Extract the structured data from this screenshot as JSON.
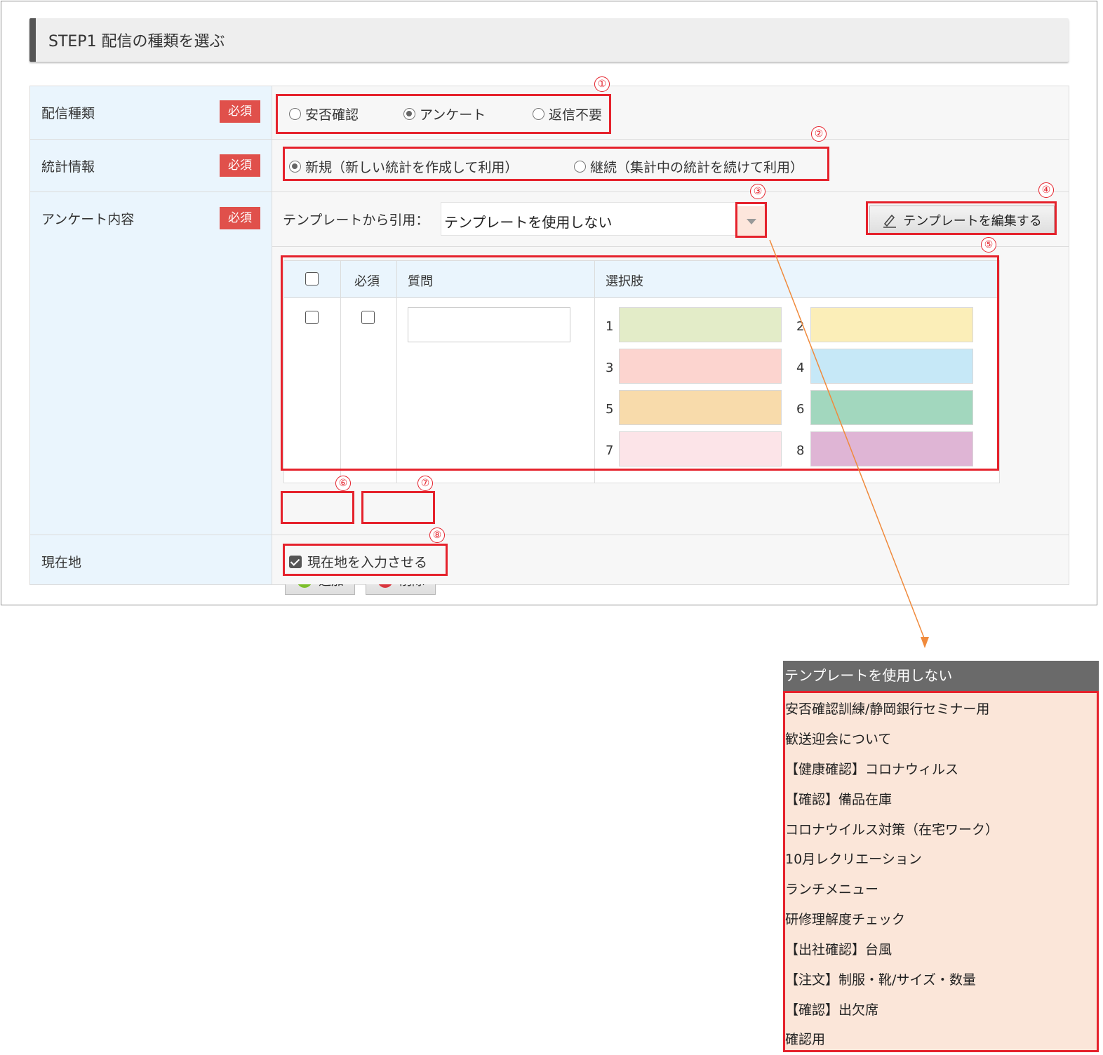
{
  "step": {
    "title": "STEP1 配信の種類を選ぶ"
  },
  "required_badge": "必須",
  "rows": {
    "delivery_type": {
      "label": "配信種類",
      "options": [
        "安否確認",
        "アンケート",
        "返信不要"
      ],
      "selected": "アンケート"
    },
    "statistics": {
      "label": "統計情報",
      "options": [
        "新規（新しい統計を作成して利用）",
        "継続（集計中の統計を続けて利用）"
      ],
      "selected": "新規（新しい統計を作成して利用）"
    },
    "survey": {
      "label": "アンケート内容",
      "template_label": "テンプレートから引用：",
      "template_value": "テンプレートを使用しない",
      "edit_template_button": "テンプレートを編集する",
      "table": {
        "headers": {
          "required": "必須",
          "question": "質問",
          "choices": "選択肢"
        },
        "choice_numbers": [
          "1",
          "2",
          "3",
          "4",
          "5",
          "6",
          "7",
          "8"
        ],
        "choice_colors": [
          "#e3ecc8",
          "#fbeeb8",
          "#fcd4cf",
          "#c6e8f7",
          "#f8dbab",
          "#a2d7be",
          "#fce4e8",
          "#dfb5d5"
        ]
      },
      "add_button": "追加",
      "delete_button": "削除"
    },
    "location": {
      "label": "現在地",
      "checkbox_label": "現在地を入力させる",
      "checked": true
    }
  },
  "callouts": [
    "①",
    "②",
    "③",
    "④",
    "⑤",
    "⑥",
    "⑦",
    "⑧"
  ],
  "dropdown": {
    "header": "テンプレートを使用しない",
    "items": [
      "安否確認訓練/静岡銀行セミナー用",
      "歓送迎会について",
      "【健康確認】コロナウィルス",
      "【確認】備品在庫",
      "コロナウイルス対策（在宅ワーク）",
      "10月レクリエーション",
      "ランチメニュー",
      "研修理解度チェック",
      "【出社確認】台風",
      "【注文】制服・靴/サイズ・数量",
      "【確認】出欠席",
      "確認用"
    ]
  },
  "colors": {
    "accent_red": "#e5222c",
    "badge_red": "#e0504b",
    "label_bg": "#eaf5fd",
    "arrow": "#f08a3c"
  }
}
